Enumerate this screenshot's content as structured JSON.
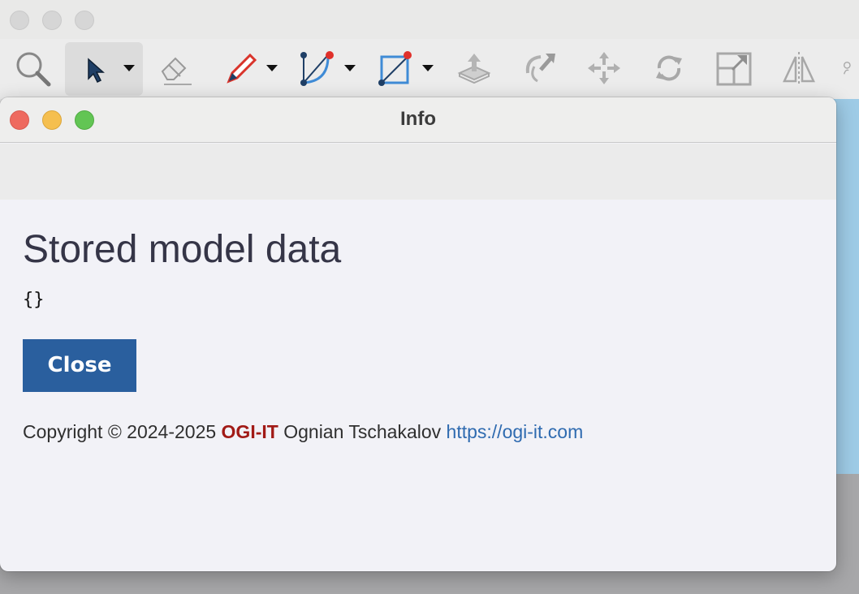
{
  "toolbar": {
    "tools": [
      {
        "name": "zoom-tool"
      },
      {
        "name": "select-tool"
      },
      {
        "name": "eraser-tool"
      },
      {
        "name": "pen-tool"
      },
      {
        "name": "arc-tool"
      },
      {
        "name": "rectangle-tool"
      },
      {
        "name": "extrude-tool"
      },
      {
        "name": "revolve-tool"
      },
      {
        "name": "move-tool"
      },
      {
        "name": "rotate-tool"
      },
      {
        "name": "scale-tool"
      },
      {
        "name": "mirror-tool"
      }
    ]
  },
  "dialog": {
    "title": "Info",
    "heading": "Stored model data",
    "model_data": "{}",
    "close_label": "Close",
    "footer": {
      "copyright": "Copyright © 2024-2025",
      "brand": "OGI-IT",
      "author": "Ognian Tschakalov",
      "link": "https://ogi-it.com"
    }
  },
  "colors": {
    "button": "#2a5f9e",
    "brand": "#a11a16",
    "link": "#2f6bb0",
    "heading": "#353547"
  }
}
